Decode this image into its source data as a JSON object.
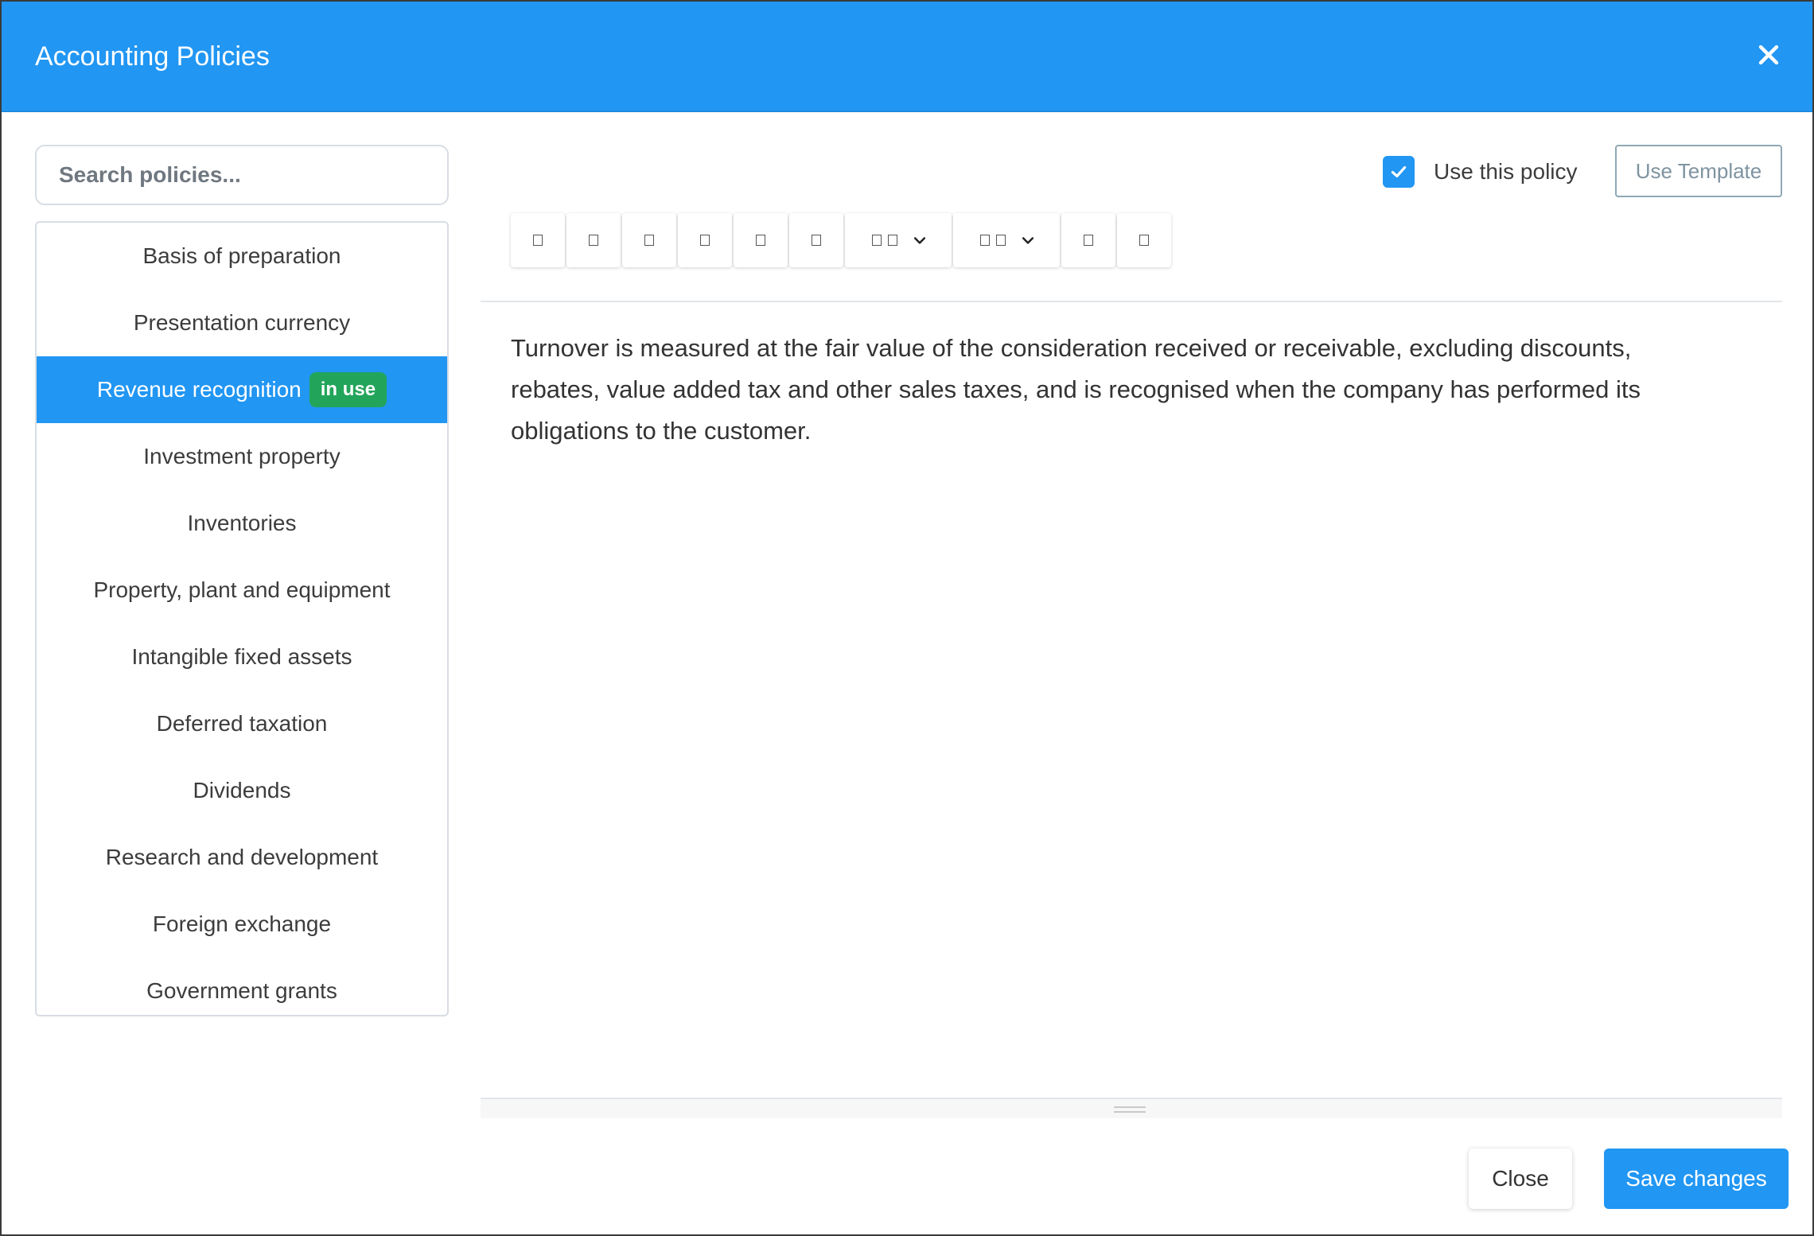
{
  "modal": {
    "title": "Accounting Policies"
  },
  "search": {
    "placeholder": "Search policies..."
  },
  "policies": {
    "items": [
      {
        "label": "Basis of preparation"
      },
      {
        "label": "Presentation currency"
      },
      {
        "label": "Revenue recognition",
        "badge": "in use",
        "selected": true
      },
      {
        "label": "Investment property"
      },
      {
        "label": "Inventories"
      },
      {
        "label": "Property, plant and equipment"
      },
      {
        "label": "Intangible fixed assets"
      },
      {
        "label": "Deferred taxation"
      },
      {
        "label": "Dividends"
      },
      {
        "label": "Research and development"
      },
      {
        "label": "Foreign exchange"
      },
      {
        "label": "Government grants"
      }
    ]
  },
  "editor": {
    "use_policy_label": "Use this policy",
    "use_policy_checked": true,
    "use_template_label": "Use Template",
    "content": "Turnover is measured at the fair value of the consideration received or receivable, excluding discounts, rebates, value added tax and other sales taxes, and is recognised when the company has performed its obligations to the customer."
  },
  "toolbar": {
    "icons": [
      "bold-icon",
      "italic-icon",
      "underline-icon",
      "strikethrough-icon",
      "unordered-list-icon",
      "ordered-list-icon",
      "paragraph-style-icon",
      "align-icon",
      "link-icon",
      "table-icon"
    ]
  },
  "footer": {
    "close_label": "Close",
    "save_label": "Save changes"
  },
  "colors": {
    "primary": "#2196f3",
    "badge": "#22a55a"
  }
}
